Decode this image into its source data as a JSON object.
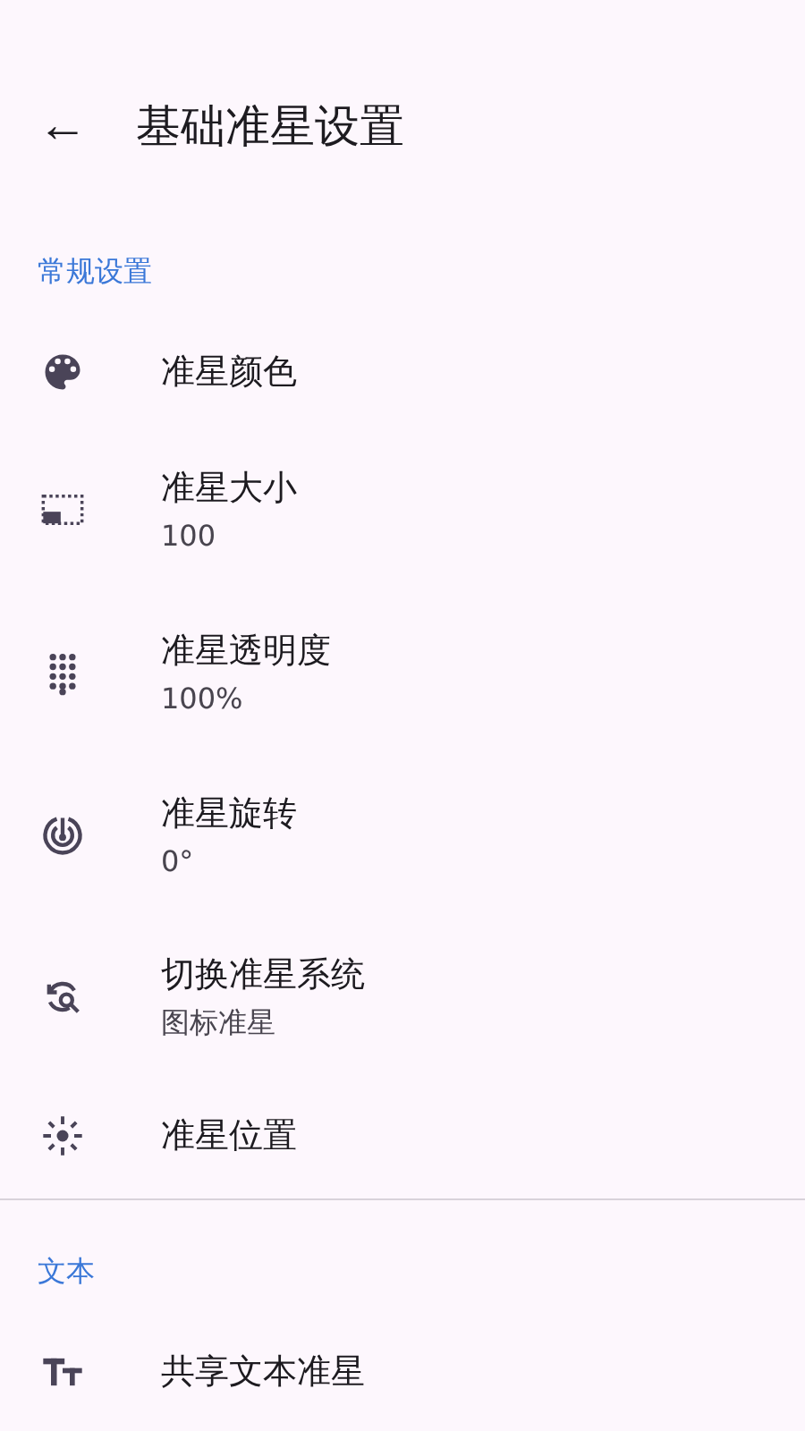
{
  "app_bar": {
    "back": "←",
    "title": "基础准星设置"
  },
  "sections": [
    {
      "title": "常规设置",
      "items": [
        {
          "title": "准星颜色"
        },
        {
          "title": "准星大小",
          "summary": "100"
        },
        {
          "title": "准星透明度",
          "summary": "100%"
        },
        {
          "title": "准星旋转",
          "summary": "0°"
        },
        {
          "title": "切换准星系统",
          "summary": "图标准星"
        },
        {
          "title": "准星位置"
        }
      ]
    },
    {
      "title": "文本",
      "items": [
        {
          "title": "共享文本准星"
        }
      ]
    }
  ]
}
